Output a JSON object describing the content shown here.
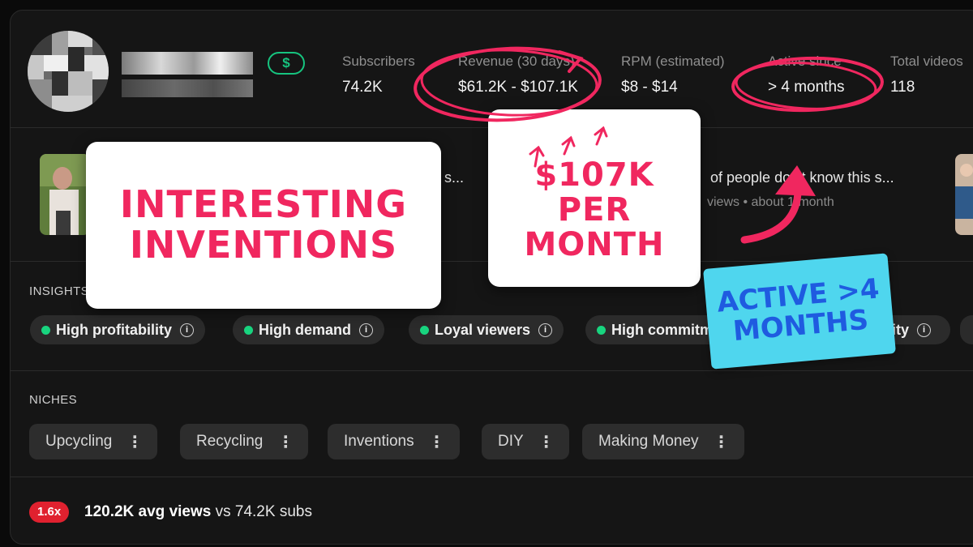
{
  "channel": {
    "badge": "$"
  },
  "stats": [
    {
      "label": "Subscribers",
      "value": "74.2K"
    },
    {
      "label": "Revenue (30 days)",
      "value": "$61.2K - $107.1K"
    },
    {
      "label": "RPM (estimated)",
      "value": "$8 - $14"
    },
    {
      "label": "Active since",
      "value": "> 4 months"
    },
    {
      "label": "Total videos",
      "value": "118"
    }
  ],
  "videos": {
    "title_fragment_1": "s...",
    "title_fragment_2": "of people don't know this s...",
    "meta_fragment_2": "views • about 1 month"
  },
  "insights": {
    "label": "INSIGHTS",
    "items": [
      {
        "label": "High profitability"
      },
      {
        "label": "High demand"
      },
      {
        "label": "Loyal viewers"
      },
      {
        "label": "High commitment"
      },
      {
        "label": "ity"
      }
    ]
  },
  "niches": {
    "label": "NICHES",
    "items": [
      "Upcycling",
      "Recycling",
      "Inventions",
      "DIY",
      "Making Money"
    ]
  },
  "footer": {
    "ratio": "1.6x",
    "avg_views": "120.2K avg views",
    "suffix": "vs 74.2K subs"
  },
  "overlays": {
    "card_title": "INTERESTING INVENTIONS",
    "card_revenue": "$107K PER MONTH",
    "sticker_active": "ACTIVE >4 MONTHS"
  },
  "colors": {
    "background": "#151515",
    "accent_green": "#16c47f",
    "annotation_pink": "#f0275f",
    "sticker_blue": "#4fd6ee",
    "ratio_red": "#e0212f"
  }
}
